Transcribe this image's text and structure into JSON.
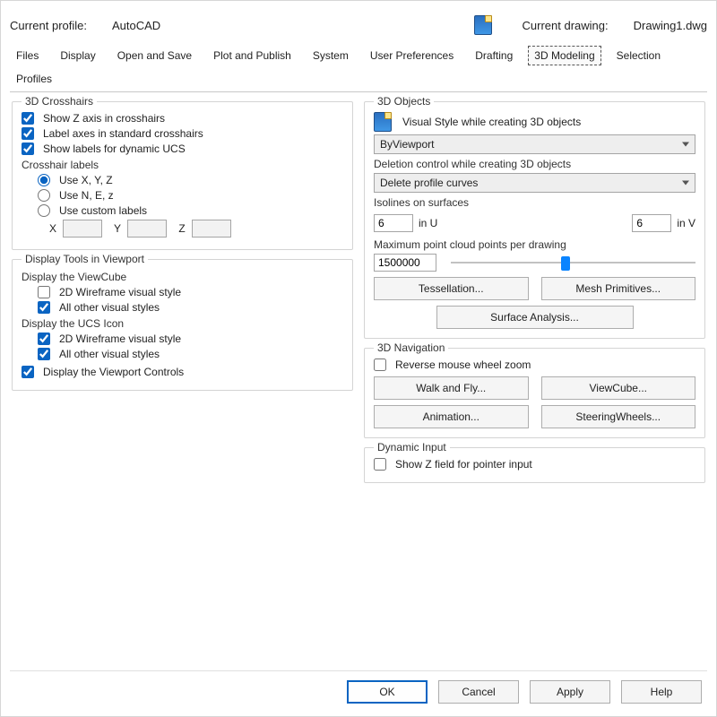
{
  "header": {
    "profile_label": "Current profile:",
    "profile_value": "AutoCAD",
    "drawing_label": "Current drawing:",
    "drawing_value": "Drawing1.dwg"
  },
  "tabs": [
    "Files",
    "Display",
    "Open and Save",
    "Plot and Publish",
    "System",
    "User Preferences",
    "Drafting",
    "3D Modeling",
    "Selection",
    "Profiles"
  ],
  "active_tab_index": 7,
  "left": {
    "crosshairs": {
      "legend": "3D Crosshairs",
      "show_z": "Show Z axis in crosshairs",
      "label_std": "Label axes in standard crosshairs",
      "show_ucs": "Show labels for dynamic UCS",
      "labels_hdr": "Crosshair labels",
      "opt_xyz": "Use X, Y, Z",
      "opt_nez": "Use N, E, z",
      "opt_custom": "Use custom labels",
      "x": "X",
      "y": "Y",
      "z": "Z"
    },
    "viewport_tools": {
      "legend": "Display Tools in Viewport",
      "viewcube_hdr": "Display the ViewCube",
      "vc_2d": "2D Wireframe visual style",
      "vc_other": "All other visual styles",
      "ucs_hdr": "Display the UCS Icon",
      "ucs_2d": "2D Wireframe visual style",
      "ucs_other": "All other visual styles",
      "vp_controls": "Display the Viewport Controls"
    }
  },
  "right": {
    "objects": {
      "legend": "3D Objects",
      "vs_label": "Visual Style while creating 3D objects",
      "vs_value": "ByViewport",
      "del_label": "Deletion control while creating 3D objects",
      "del_value": "Delete profile curves",
      "iso_label": "Isolines on surfaces",
      "iso_u": "6",
      "iso_u_lbl": "in U",
      "iso_v": "6",
      "iso_v_lbl": "in V",
      "max_label": "Maximum point cloud points per drawing",
      "max_value": "1500000",
      "btn_tess": "Tessellation...",
      "btn_mesh": "Mesh Primitives...",
      "btn_surf": "Surface Analysis..."
    },
    "nav": {
      "legend": "3D Navigation",
      "reverse": "Reverse mouse wheel zoom",
      "btn_walkfly": "Walk and Fly...",
      "btn_viewcube": "ViewCube...",
      "btn_anim": "Animation...",
      "btn_steer": "SteeringWheels..."
    },
    "dyn": {
      "legend": "Dynamic Input",
      "showz": "Show Z field for pointer input"
    }
  },
  "footer": {
    "ok": "OK",
    "cancel": "Cancel",
    "apply": "Apply",
    "help": "Help"
  }
}
